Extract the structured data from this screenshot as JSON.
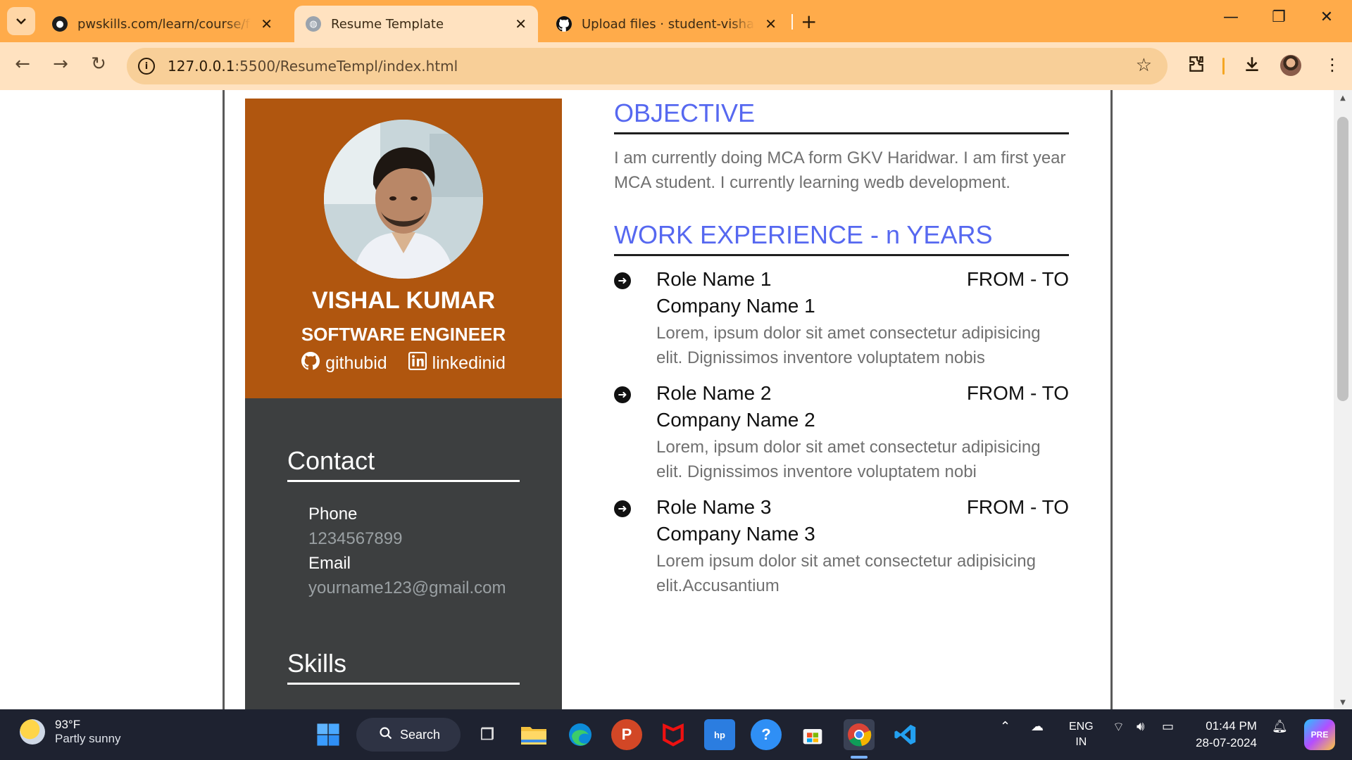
{
  "browser": {
    "tabs": [
      {
        "title": "pwskills.com/learn/course/full-s",
        "active": false
      },
      {
        "title": "Resume Template",
        "active": true
      },
      {
        "title": "Upload files · student-vishalkun",
        "active": false
      }
    ],
    "url_host": "127.0.0.1",
    "url_path": ":5500/ResumeTempl/index.html"
  },
  "resume": {
    "name": "VISHAL KUMAR",
    "title": "SOFTWARE ENGINEER",
    "github": "githubid",
    "linkedin": "linkedinid",
    "contact_heading": "Contact",
    "phone_label": "Phone",
    "phone": "1234567899",
    "email_label": "Email",
    "email": "yourname123@gmail.com",
    "skills_heading": "Skills",
    "objective_heading": "OBJECTIVE",
    "objective_text": "I am currently doing MCA form GKV Haridwar. I am first year MCA student. I currently learning wedb development.",
    "work_heading": "WORK EXPERIENCE - n YEARS",
    "jobs": [
      {
        "role": "Role Name 1",
        "period": "FROM - TO",
        "company": "Company Name 1",
        "desc": "Lorem, ipsum dolor sit amet consectetur adipisicing elit. Dignissimos inventore voluptatem nobis"
      },
      {
        "role": "Role Name 2",
        "period": "FROM - TO",
        "company": "Company Name 2",
        "desc": "Lorem, ipsum dolor sit amet consectetur adipisicing elit. Dignissimos inventore voluptatem nobi"
      },
      {
        "role": "Role Name 3",
        "period": "FROM - TO",
        "company": "Company Name 3",
        "desc": "Lorem ipsum dolor sit amet consectetur adipisicing elit.Accusantium"
      }
    ]
  },
  "taskbar": {
    "temperature": "93°F",
    "weather": "Partly sunny",
    "search": "Search",
    "lang1": "ENG",
    "lang2": "IN",
    "time": "01:44 PM",
    "date": "28-07-2024"
  },
  "colors": {
    "tabbar": "#ffab4a",
    "toolbar": "#ffe2c0",
    "profile_bg": "#b0560f",
    "sidebar_bg": "#3d3f40",
    "heading_blue": "#5668f0"
  },
  "icons": [
    "tab-search-icon",
    "github-favicon",
    "back-arrow-icon",
    "forward-arrow-icon",
    "reload-icon",
    "site-info-icon",
    "bookmark-star-icon",
    "extensions-icon",
    "download-icon",
    "menu-icon",
    "github-icon",
    "linkedin-icon",
    "arrow-circle-icon",
    "windows-start-icon",
    "search-icon"
  ]
}
